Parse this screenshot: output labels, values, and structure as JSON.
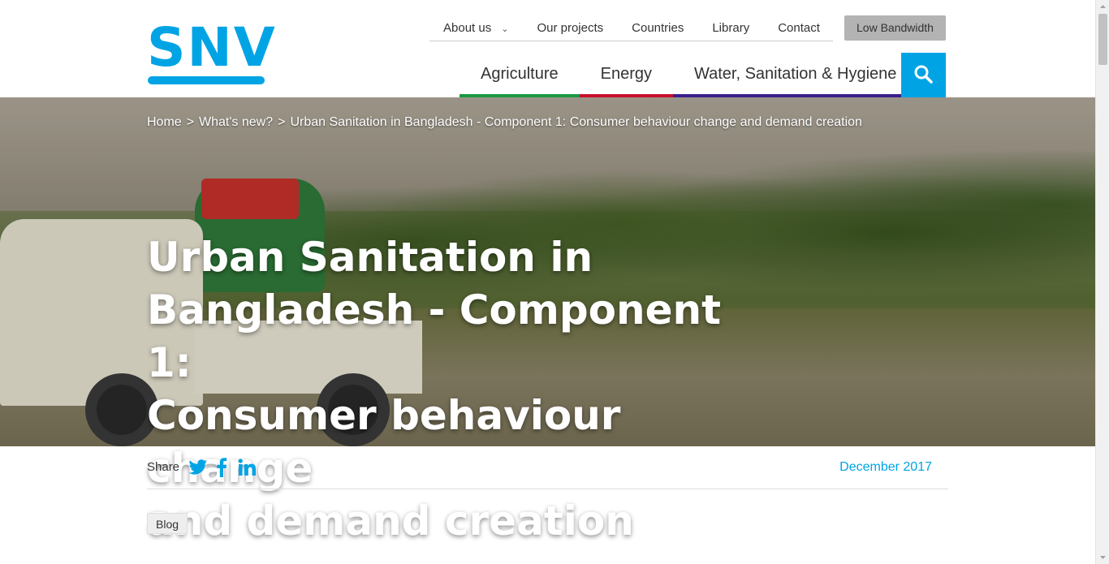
{
  "logo": {
    "text": "SNV"
  },
  "topnav": [
    {
      "label": "About us",
      "has_dropdown": true
    },
    {
      "label": "Our projects"
    },
    {
      "label": "Countries"
    },
    {
      "label": "Library"
    },
    {
      "label": "Contact"
    }
  ],
  "low_bandwidth_label": "Low Bandwidth",
  "mainnav": [
    {
      "label": "Agriculture",
      "accent": "#1a9a43"
    },
    {
      "label": "Energy",
      "accent": "#c8102e"
    },
    {
      "label": "Water, Sanitation & Hygiene",
      "accent": "#3a1f8c"
    }
  ],
  "search": {
    "icon": "search-icon",
    "color": "#00a4e4"
  },
  "breadcrumb": {
    "items": [
      "Home",
      "What's new?",
      "Urban Sanitation in Bangladesh - Component 1: Consumer behaviour change and demand creation"
    ],
    "separator": ">"
  },
  "hero": {
    "title_lines": [
      "Urban Sanitation in",
      "Bangladesh - Component 1:",
      "Consumer behaviour change",
      "and demand creation"
    ]
  },
  "share": {
    "label": "Share",
    "icons": [
      "twitter-icon",
      "facebook-icon",
      "linkedin-icon"
    ]
  },
  "date": "December 2017",
  "tag": "Blog"
}
